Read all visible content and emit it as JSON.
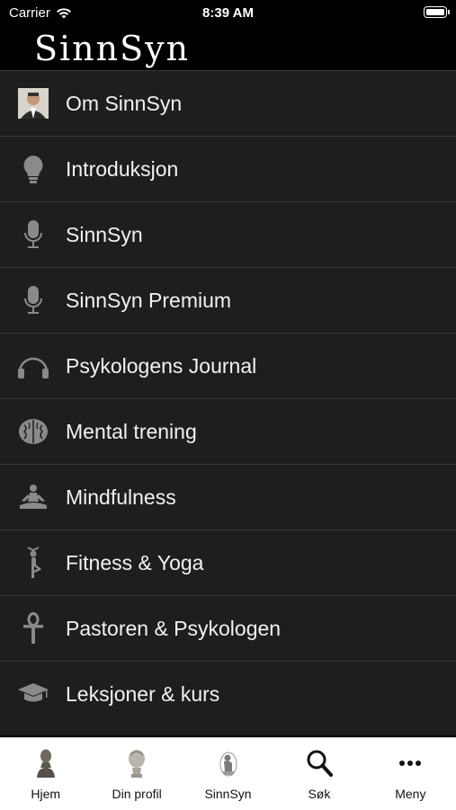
{
  "status_bar": {
    "carrier": "Carrier",
    "time": "8:39 AM"
  },
  "header": {
    "logo_text": "SinnSyn"
  },
  "menu": {
    "items": [
      {
        "label": "Om SinnSyn",
        "icon": "person-photo-icon"
      },
      {
        "label": "Introduksjon",
        "icon": "lightbulb-icon"
      },
      {
        "label": "SinnSyn",
        "icon": "microphone-icon"
      },
      {
        "label": "SinnSyn Premium",
        "icon": "microphone-icon"
      },
      {
        "label": "Psykologens Journal",
        "icon": "headphones-icon"
      },
      {
        "label": "Mental trening",
        "icon": "brain-icon"
      },
      {
        "label": "Mindfulness",
        "icon": "meditation-icon"
      },
      {
        "label": "Fitness & Yoga",
        "icon": "yoga-pose-icon"
      },
      {
        "label": "Pastoren & Psykologen",
        "icon": "ankh-icon"
      },
      {
        "label": "Leksjoner & kurs",
        "icon": "graduation-cap-icon"
      }
    ]
  },
  "tabbar": {
    "tabs": [
      {
        "label": "Hjem",
        "icon": "bust-statue-icon"
      },
      {
        "label": "Din profil",
        "icon": "head-statue-icon"
      },
      {
        "label": "SinnSyn",
        "icon": "thinker-statue-icon"
      },
      {
        "label": "Søk",
        "icon": "search-icon"
      },
      {
        "label": "Meny",
        "icon": "more-dots-icon"
      }
    ]
  }
}
